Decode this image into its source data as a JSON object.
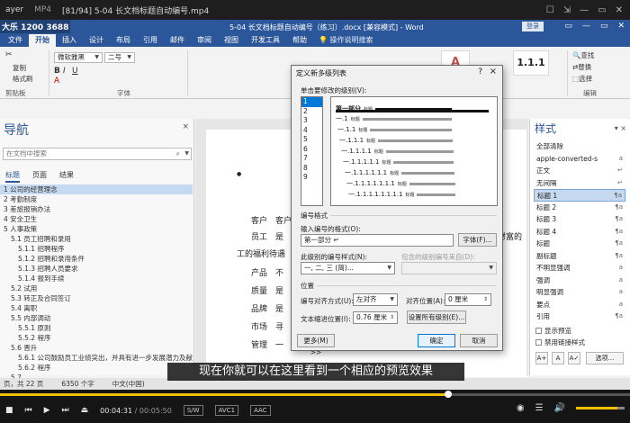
{
  "player": {
    "menu_label": "ayer",
    "format": "MP4",
    "title": "[81/94] 5-04 长文档标题自动编号.mp4",
    "window_icons": [
      "☐",
      "⇲",
      "—",
      "▭",
      "✕"
    ],
    "watermark": "大乐 1200 3688"
  },
  "word": {
    "doc_title": "5-04 长文档标题自动编号（练习）.docx [兼容模式] - Word",
    "login": "登录",
    "window_controls": [
      "▭",
      "—",
      "▭",
      "✕"
    ],
    "tabs": [
      "文件",
      "开始",
      "插入",
      "设计",
      "布局",
      "引用",
      "邮件",
      "审阅",
      "视图",
      "开发工具",
      "帮助"
    ],
    "tell_me": "操作说明搜索",
    "ribbon": {
      "cut": "✂",
      "copy": "复制",
      "format_painter": "格式刷",
      "clipboard_group": "剪贴板",
      "font_name": "微软雅黑",
      "font_size": "二号",
      "font_group": "字体",
      "style_preview_1": "A",
      "style_preview_2": "1.1.1",
      "find": "查找",
      "replace": "替换",
      "select": "选择",
      "editing_group": "编辑"
    }
  },
  "nav": {
    "title": "导航",
    "close": "×",
    "search_placeholder": "在文档中搜索",
    "tabs": [
      "标题",
      "页面",
      "结果"
    ],
    "items": [
      "1 公司的经营理念",
      "2 考勤制度",
      "3 差旅报销办法",
      "4 安全卫生",
      "5 人事政策",
      "5.1 员工招聘和录用",
      "5.1.1 招聘程序",
      "5.1.2 招聘和录用条件",
      "5.1.3 招聘人员要求",
      "5.1.4 报到手续",
      "5.2 试用",
      "5.3 转正及合同签订",
      "5.4 离职",
      "5.5 内部调动",
      "5.5.1 原则",
      "5.5.2 程序",
      "5.6 晋升",
      "5.6.1 公司鼓励员工业绩突出，并具有进一步发展潜力及献身精神",
      "5.6.2 程序",
      "5.7 ..."
    ]
  },
  "doc": {
    "lines": [
      "客户",
      "客户",
      "员工",
      "是",
      "工的福利待遇",
      "产品",
      "不",
      "质量",
      "是",
      "品牌",
      "是",
      "市场",
      "寻",
      "管理",
      "一",
      "财富的"
    ]
  },
  "styles": {
    "title": "样式",
    "items": [
      {
        "name": "全部清除",
        "mark": ""
      },
      {
        "name": "apple-converted-s",
        "mark": "a"
      },
      {
        "name": "正文",
        "mark": "↵"
      },
      {
        "name": "无间隔",
        "mark": "↵"
      },
      {
        "name": "标题 1",
        "mark": "¶a"
      },
      {
        "name": "标题 2",
        "mark": "¶a"
      },
      {
        "name": "标题 3",
        "mark": "¶a"
      },
      {
        "name": "标题 4",
        "mark": "¶a"
      },
      {
        "name": "标题",
        "mark": "¶a"
      },
      {
        "name": "副标题",
        "mark": "¶a"
      },
      {
        "name": "不明显强调",
        "mark": "a"
      },
      {
        "name": "强调",
        "mark": "a"
      },
      {
        "name": "明显强调",
        "mark": "a"
      },
      {
        "name": "要点",
        "mark": "a"
      },
      {
        "name": "引用",
        "mark": "¶a"
      }
    ],
    "show_preview": "显示预览",
    "disable_linked": "禁用链接样式",
    "options_btn": "选项..."
  },
  "dialog": {
    "title": "定义新多级列表",
    "help": "?",
    "close": "×",
    "level_label": "单击要修改的级别(V):",
    "levels": [
      "1",
      "2",
      "3",
      "4",
      "5",
      "6",
      "7",
      "8",
      "9"
    ],
    "preview_lines": [
      "第一部分",
      "一.1",
      "一.1.1",
      "一.1.1.1",
      "一.1.1.1.1",
      "一.1.1.1.1.1",
      "一.1.1.1.1.1.1",
      "一.1.1.1.1.1.1.1",
      "一.1.1.1.1.1.1.1.1"
    ],
    "preview_tag": "标题",
    "number_format_section": "编号格式",
    "input_format_label": "输入编号的格式(O):",
    "input_format_value": "第一部分 ↵",
    "font_btn": "字体(F)...",
    "number_style_label": "此级别的编号样式(N):",
    "number_style_value": "一, 二, 三 (简)...",
    "include_level_label": "包含的级别编号来自(D):",
    "position_section": "位置",
    "alignment_label": "编号对齐方式(U):",
    "alignment_value": "左对齐",
    "align_at_label": "对齐位置(A):",
    "align_at_value": "0 厘米",
    "text_indent_label": "文本缩进位置(I):",
    "text_indent_value": "0.76 厘米",
    "set_all_btn": "设置所有级别(E)...",
    "more_btn": "更多(M) >>",
    "ok_btn": "确定",
    "cancel_btn": "取消"
  },
  "subtitle": "现在你就可以在这里看到一个相应的预览效果",
  "statusbar": {
    "page": "页，共 22 页",
    "words": "6350 个字",
    "lang": "中文(中国)"
  },
  "playback": {
    "progress": 0.712,
    "current": "00:04:31",
    "total": "00:05:50",
    "tags": [
      "S/W",
      "AVC1",
      "AAC"
    ],
    "volume": 0.85
  },
  "colors": {
    "word_blue": "#2b579a",
    "progress": "#f0c000"
  }
}
